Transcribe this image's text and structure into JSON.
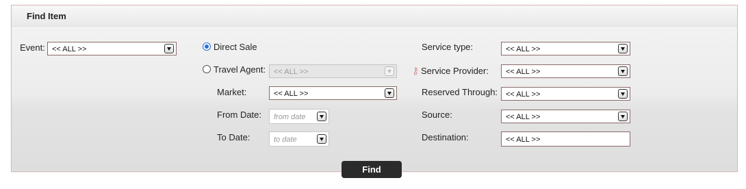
{
  "panel": {
    "title": "Find Item"
  },
  "form": {
    "event": {
      "label": "Event:",
      "value": "<< ALL >>"
    },
    "direct_sale": {
      "label": "Direct Sale",
      "checked": true
    },
    "travel_agent": {
      "label": "Travel Agent:",
      "value": "<< ALL >>",
      "disabled": true
    },
    "market": {
      "label": "Market:",
      "value": "<< ALL >>"
    },
    "from_date": {
      "label": "From Date:",
      "placeholder": "from date"
    },
    "to_date": {
      "label": "To Date:",
      "placeholder": "to date"
    },
    "service_type": {
      "label": "Service type:",
      "value": "<< ALL >>"
    },
    "service_provider": {
      "label": "Service Provider:",
      "value": "<< ALL >>"
    },
    "reserved_through": {
      "label": "Reserved Through:",
      "value": "<< ALL >>"
    },
    "source": {
      "label": "Source:",
      "value": "<< ALL >>"
    },
    "destination": {
      "label": "Destination:",
      "value": "<< ALL >>"
    }
  },
  "actions": {
    "find_label": "Find"
  },
  "icons": {
    "help": "help-key-icon",
    "dropdown": "chevron-down-icon"
  },
  "colors": {
    "accent": "#2a6fd6",
    "button_bg": "#2b2b2b",
    "panel_border": "#d9b8b8"
  }
}
